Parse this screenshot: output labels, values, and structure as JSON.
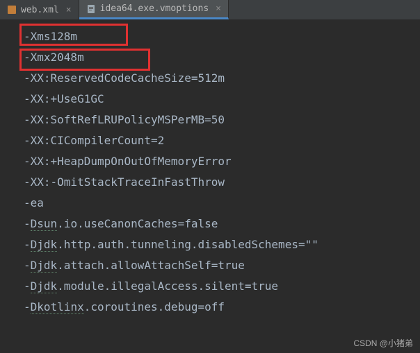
{
  "tabs": [
    {
      "label": "web.xml",
      "active": false
    },
    {
      "label": "idea64.exe.vmoptions",
      "active": true
    }
  ],
  "editor": {
    "lines": [
      "-Xms128m",
      "-Xmx2048m",
      "-XX:ReservedCodeCacheSize=512m",
      "-XX:+UseG1GC",
      "-XX:SoftRefLRUPolicyMSPerMB=50",
      "-XX:CICompilerCount=2",
      "-XX:+HeapDumpOnOutOfMemoryError",
      "-XX:-OmitStackTraceInFastThrow",
      "-ea",
      "-Dsun.io.useCanonCaches=false",
      "-Djdk.http.auth.tunneling.disabledSchemes=\"\"",
      "-Djdk.attach.allowAttachSelf=true",
      "-Djdk.module.illegalAccess.silent=true",
      "-Dkotlinx.coroutines.debug=off"
    ],
    "highlighted_lines": [
      0,
      1
    ],
    "underline_prefixes": {
      "9": "Dsun",
      "10": "Djdk",
      "11": "Djdk",
      "12": "Djdk",
      "13": "Dkotlinx"
    }
  },
  "watermark": "CSDN @小猪弟"
}
